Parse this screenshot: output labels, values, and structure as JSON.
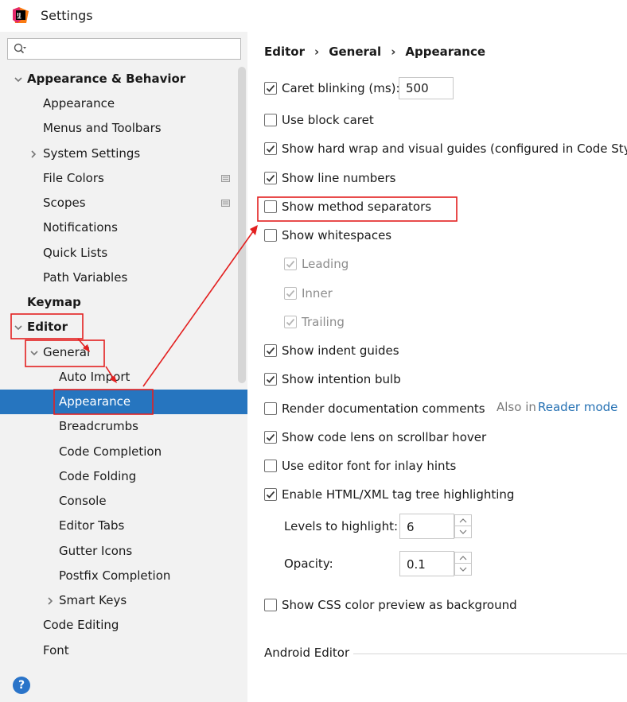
{
  "window": {
    "title": "Settings",
    "logo_letters": "IJ"
  },
  "search": {
    "value": ""
  },
  "tree": {
    "items": [
      {
        "label": "Appearance & Behavior",
        "bold": true,
        "expanded": true
      },
      {
        "label": "Appearance"
      },
      {
        "label": "Menus and Toolbars"
      },
      {
        "label": "System Settings",
        "expandable": true
      },
      {
        "label": "File Colors",
        "project_icon": true
      },
      {
        "label": "Scopes",
        "project_icon": true
      },
      {
        "label": "Notifications"
      },
      {
        "label": "Quick Lists"
      },
      {
        "label": "Path Variables"
      },
      {
        "label": "Keymap",
        "bold": true
      },
      {
        "label": "Editor",
        "bold": true,
        "expanded": true
      },
      {
        "label": "General",
        "expanded": true
      },
      {
        "label": "Auto Import"
      },
      {
        "label": "Appearance",
        "selected": true
      },
      {
        "label": "Breadcrumbs"
      },
      {
        "label": "Code Completion"
      },
      {
        "label": "Code Folding"
      },
      {
        "label": "Console"
      },
      {
        "label": "Editor Tabs"
      },
      {
        "label": "Gutter Icons"
      },
      {
        "label": "Postfix Completion"
      },
      {
        "label": "Smart Keys",
        "expandable": true
      },
      {
        "label": "Code Editing"
      },
      {
        "label": "Font"
      }
    ]
  },
  "breadcrumb": {
    "items": [
      "Editor",
      "General",
      "Appearance"
    ]
  },
  "options": {
    "caret_blinking": {
      "label": "Caret blinking (ms):",
      "checked": true,
      "value": "500"
    },
    "block_caret": {
      "label": "Use block caret",
      "checked": false
    },
    "hard_wrap": {
      "label": "Show hard wrap and visual guides (configured in Code Style)",
      "checked": true
    },
    "line_numbers": {
      "label": "Show line numbers",
      "checked": true
    },
    "method_separators": {
      "label": "Show method separators",
      "checked": false
    },
    "whitespaces": {
      "label": "Show whitespaces",
      "checked": false
    },
    "leading": {
      "label": "Leading",
      "checked": true,
      "disabled": true
    },
    "inner": {
      "label": "Inner",
      "checked": true,
      "disabled": true
    },
    "trailing": {
      "label": "Trailing",
      "checked": true,
      "disabled": true
    },
    "indent_guides": {
      "label": "Show indent guides",
      "checked": true
    },
    "intention_bulb": {
      "label": "Show intention bulb",
      "checked": true
    },
    "render_docs": {
      "label": "Render documentation comments",
      "checked": false,
      "also_in": "Also in",
      "link": "Reader mode"
    },
    "code_lens": {
      "label": "Show code lens on scrollbar hover",
      "checked": true
    },
    "editor_font_hints": {
      "label": "Use editor font for inlay hints",
      "checked": false
    },
    "tag_tree": {
      "label": "Enable HTML/XML tag tree highlighting",
      "checked": true
    },
    "levels": {
      "label": "Levels to highlight:",
      "value": "6"
    },
    "opacity": {
      "label": "Opacity:",
      "value": "0.1"
    },
    "css_preview": {
      "label": "Show CSS color preview as background",
      "checked": false
    }
  },
  "sections": {
    "android_editor": "Android Editor"
  },
  "colors": {
    "selection": "#2675bf",
    "annotation": "#e32020",
    "link": "#2470b3"
  }
}
